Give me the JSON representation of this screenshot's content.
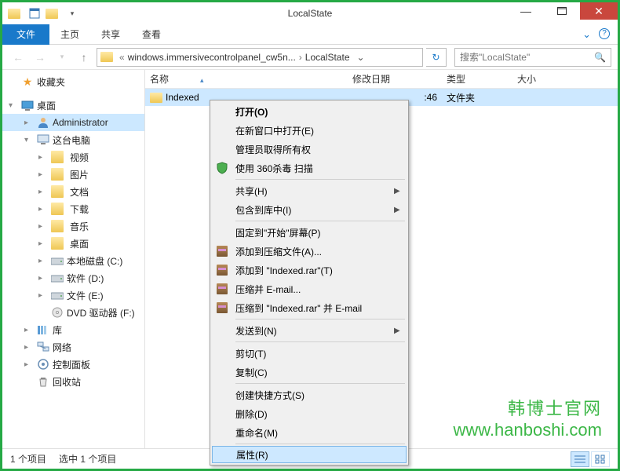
{
  "window": {
    "title": "LocalState"
  },
  "ribbon": {
    "file": "文件",
    "home": "主页",
    "share": "共享",
    "view": "查看"
  },
  "nav": {
    "path_prefix": "«",
    "path_seg1": "windows.immersivecontrolpanel_cw5n...",
    "path_seg2": "LocalState",
    "search_placeholder": "搜索\"LocalState\""
  },
  "sidebar": {
    "favorites": "收藏夹",
    "desktop": "桌面",
    "admin": "Administrator",
    "thispc": "这台电脑",
    "videos": "视频",
    "pictures": "图片",
    "documents": "文档",
    "downloads": "下载",
    "music": "音乐",
    "desktop2": "桌面",
    "drive_c": "本地磁盘 (C:)",
    "drive_d": "软件 (D:)",
    "drive_e": "文件 (E:)",
    "dvd": "DVD 驱动器 (F:)",
    "libraries": "库",
    "network": "网络",
    "controlpanel": "控制面板",
    "recycle": "回收站"
  },
  "columns": {
    "name": "名称",
    "date": "修改日期",
    "type": "类型",
    "size": "大小"
  },
  "files": {
    "row0": {
      "name": "Indexed",
      "date_suffix": ":46",
      "type": "文件夹"
    }
  },
  "menu": {
    "open": "打开(O)",
    "open_new": "在新窗口中打开(E)",
    "admin_own": "管理员取得所有权",
    "scan360": "使用 360杀毒 扫描",
    "share": "共享(H)",
    "addlib": "包含到库中(I)",
    "pinstart": "固定到\"开始\"屏幕(P)",
    "addrar": "添加到压缩文件(A)...",
    "addindexed": "添加到 \"Indexed.rar\"(T)",
    "zipemail": "压缩并 E-mail...",
    "zipemailto": "压缩到 \"Indexed.rar\" 并 E-mail",
    "sendto": "发送到(N)",
    "cut": "剪切(T)",
    "copy": "复制(C)",
    "shortcut": "创建快捷方式(S)",
    "delete": "删除(D)",
    "rename": "重命名(M)",
    "properties": "属性(R)"
  },
  "status": {
    "count": "1 个项目",
    "selected": "选中 1 个项目"
  },
  "watermark": {
    "l1": "韩博士官网",
    "l2": "www.hanboshi.com"
  }
}
